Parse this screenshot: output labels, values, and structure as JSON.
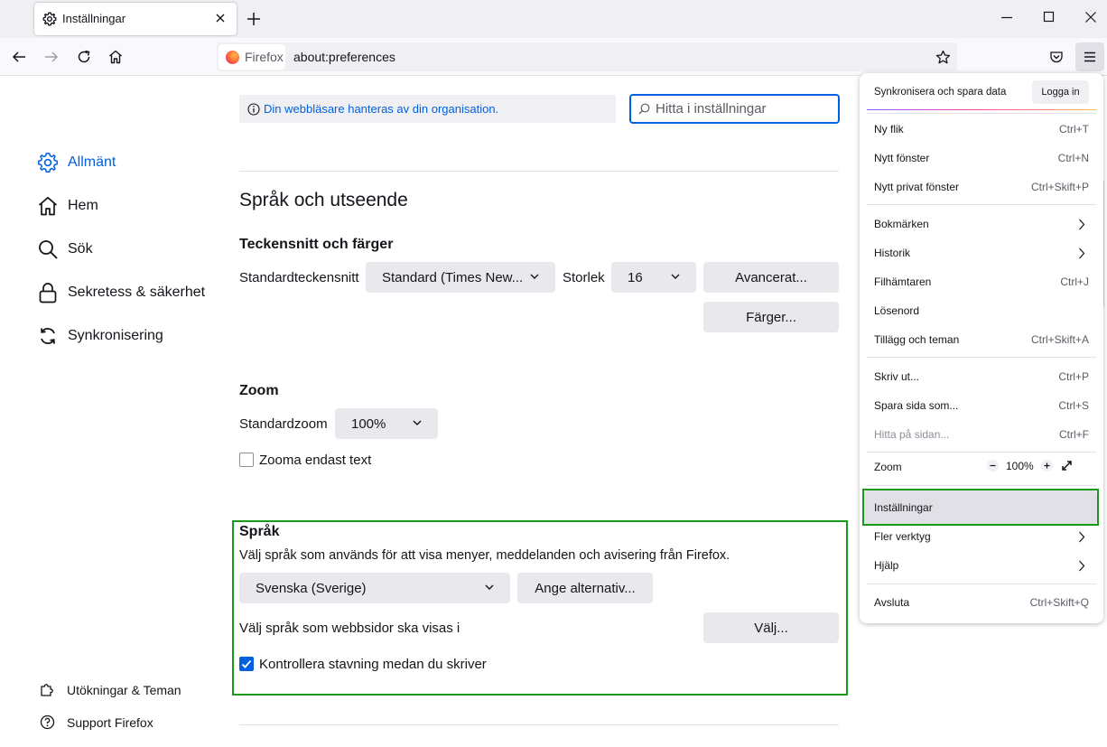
{
  "tab": {
    "title": "Inställningar"
  },
  "urlbar": {
    "identity_label": "Firefox",
    "url": "about:preferences"
  },
  "sidebar": {
    "items": [
      {
        "label": "Allmänt"
      },
      {
        "label": "Hem"
      },
      {
        "label": "Sök"
      },
      {
        "label": "Sekretess & säkerhet"
      },
      {
        "label": "Synkronisering"
      }
    ],
    "footer": [
      {
        "label": "Utökningar & Teman"
      },
      {
        "label": "Support Firefox"
      }
    ]
  },
  "notice": {
    "text": "Din webbläsare hanteras av din organisation."
  },
  "search": {
    "placeholder": "Hitta i inställningar"
  },
  "section": {
    "title": "Språk och utseende"
  },
  "fonts": {
    "heading": "Teckensnitt och färger",
    "default_font_label": "Standardteckensnitt",
    "default_font_value": "Standard (Times New...",
    "size_label": "Storlek",
    "size_value": "16",
    "advanced_button": "Avancerat...",
    "colors_button": "Färger..."
  },
  "zoom": {
    "heading": "Zoom",
    "default_zoom_label": "Standardzoom",
    "default_zoom_value": "100%",
    "text_only_label": "Zooma endast text"
  },
  "language": {
    "heading": "Språk",
    "description": "Välj språk som används för att visa menyer, meddelanden och avisering från Firefox.",
    "selected_language": "Svenska (Sverige)",
    "alternatives_button": "Ange alternativ...",
    "web_language_label": "Välj språk som webbsidor ska visas i",
    "choose_button": "Välj...",
    "spellcheck_label": "Kontrollera stavning medan du skriver"
  },
  "appmenu": {
    "sync_label": "Synkronisera och spara data",
    "login_button": "Logga in",
    "items": [
      {
        "label": "Ny flik",
        "shortcut": "Ctrl+T"
      },
      {
        "label": "Nytt fönster",
        "shortcut": "Ctrl+N"
      },
      {
        "label": "Nytt privat fönster",
        "shortcut": "Ctrl+Skift+P"
      },
      {
        "label": "Bokmärken",
        "shortcut": ""
      },
      {
        "label": "Historik",
        "shortcut": ""
      },
      {
        "label": "Filhämtaren",
        "shortcut": "Ctrl+J"
      },
      {
        "label": "Lösenord",
        "shortcut": ""
      },
      {
        "label": "Tillägg och teman",
        "shortcut": "Ctrl+Skift+A"
      },
      {
        "label": "Skriv ut...",
        "shortcut": "Ctrl+P"
      },
      {
        "label": "Spara sida som...",
        "shortcut": "Ctrl+S"
      },
      {
        "label": "Hitta på sidan...",
        "shortcut": "Ctrl+F"
      },
      {
        "label": "Zoom",
        "shortcut": ""
      },
      {
        "label": "Inställningar",
        "shortcut": ""
      },
      {
        "label": "Fler verktyg",
        "shortcut": ""
      },
      {
        "label": "Hjälp",
        "shortcut": ""
      },
      {
        "label": "Avsluta",
        "shortcut": "Ctrl+Skift+Q"
      }
    ],
    "zoom_value": "100%"
  },
  "colors": {
    "accent": "#0061e0",
    "highlight": "#1a9a1a"
  }
}
